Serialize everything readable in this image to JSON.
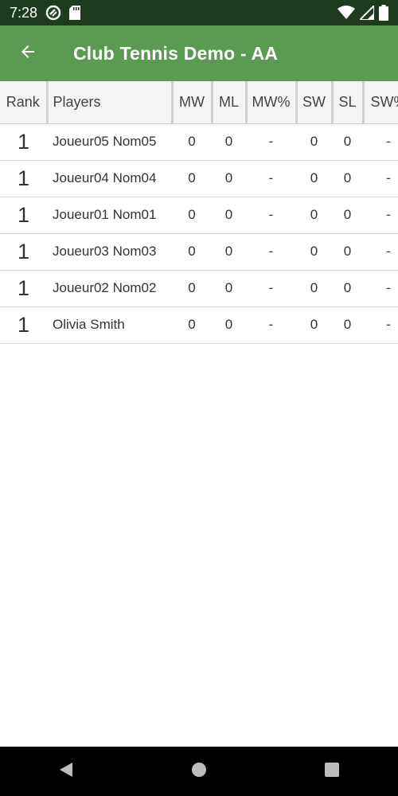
{
  "status_bar": {
    "time": "7:28",
    "icons": [
      "sync-icon",
      "sd-card-icon",
      "wifi-icon",
      "signal-icon",
      "battery-icon"
    ]
  },
  "app_bar": {
    "title": "Club Tennis Demo - AA",
    "back_icon": "arrow-left-icon"
  },
  "table": {
    "headers": {
      "rank": "Rank",
      "players": "Players",
      "mw": "MW",
      "ml": "ML",
      "mw_pct": "MW%",
      "sw": "SW",
      "sl": "SL",
      "sw_pct": "SW%"
    },
    "rows": [
      {
        "rank": "1",
        "player": "Joueur05 Nom05",
        "mw": "0",
        "ml": "0",
        "mw_pct": "-",
        "sw": "0",
        "sl": "0",
        "sw_pct": "-"
      },
      {
        "rank": "1",
        "player": "Joueur04 Nom04",
        "mw": "0",
        "ml": "0",
        "mw_pct": "-",
        "sw": "0",
        "sl": "0",
        "sw_pct": "-"
      },
      {
        "rank": "1",
        "player": "Joueur01 Nom01",
        "mw": "0",
        "ml": "0",
        "mw_pct": "-",
        "sw": "0",
        "sl": "0",
        "sw_pct": "-"
      },
      {
        "rank": "1",
        "player": "Joueur03 Nom03",
        "mw": "0",
        "ml": "0",
        "mw_pct": "-",
        "sw": "0",
        "sl": "0",
        "sw_pct": "-"
      },
      {
        "rank": "1",
        "player": "Joueur02 Nom02",
        "mw": "0",
        "ml": "0",
        "mw_pct": "-",
        "sw": "0",
        "sl": "0",
        "sw_pct": "-"
      },
      {
        "rank": "1",
        "player": "Olivia Smith",
        "mw": "0",
        "ml": "0",
        "mw_pct": "-",
        "sw": "0",
        "sl": "0",
        "sw_pct": "-"
      }
    ]
  },
  "nav_bar": {
    "icons": [
      "back-triangle-icon",
      "home-circle-icon",
      "recents-square-icon"
    ]
  },
  "colors": {
    "app_bar": "#5a9a52",
    "status_bar": "#1f3b1f",
    "nav_bar": "#000000"
  }
}
